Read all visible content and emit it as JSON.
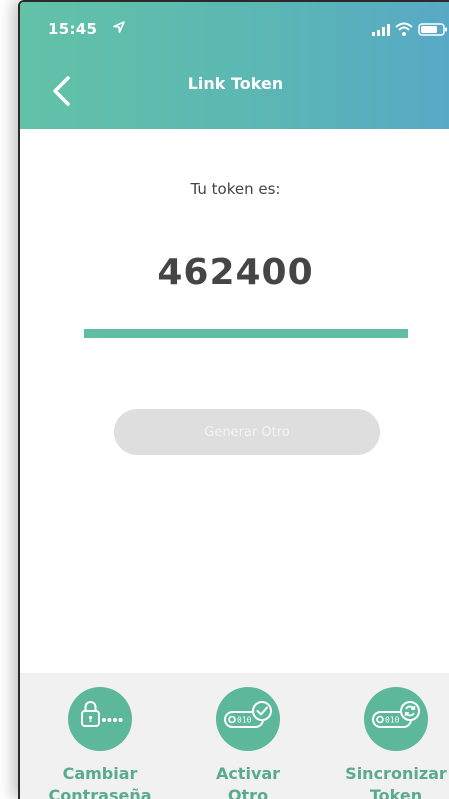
{
  "status_bar": {
    "time": "15:45"
  },
  "header": {
    "title": "Link Token"
  },
  "token": {
    "label": "Tu token es:",
    "value": "462400",
    "progress": 1.0
  },
  "generate_button": {
    "label": "Generar Otro"
  },
  "actions": [
    {
      "line1": "Cambiar",
      "line2": "Contraseña",
      "icon": "lock-password-icon"
    },
    {
      "line1": "Activar",
      "line2": "Otro",
      "icon": "token-activate-icon"
    },
    {
      "line1": "Sincronizar",
      "line2": "Token",
      "icon": "token-sync-icon"
    }
  ],
  "colors": {
    "accent": "#61bea5",
    "header_start": "#62c2a7",
    "header_end": "#58a9c6",
    "button_disabled": "#dedede"
  }
}
